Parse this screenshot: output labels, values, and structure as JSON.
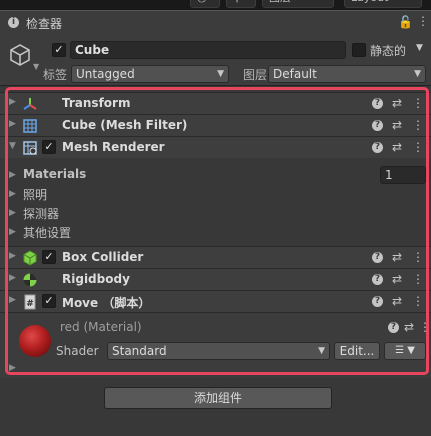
{
  "toolbar": {
    "layers_label": "图层",
    "layout_label": "Layout"
  },
  "tab": {
    "title": "检查器"
  },
  "gameobject": {
    "name": "Cube",
    "active": true,
    "static_label": "静态的",
    "tag_label": "标签",
    "tag_value": "Untagged",
    "layer_label": "图层",
    "layer_value": "Default"
  },
  "components": [
    {
      "title": "Transform",
      "checkbox": false,
      "icon": "transform-axes-icon"
    },
    {
      "title": "Cube (Mesh Filter)",
      "checkbox": false,
      "icon": "mesh-filter-grid-icon"
    },
    {
      "title": "Mesh Renderer",
      "checkbox": true,
      "icon": "mesh-renderer-icon"
    },
    {
      "title": "Box Collider",
      "checkbox": true,
      "icon": "box-collider-icon"
    },
    {
      "title": "Rigidbody",
      "checkbox": false,
      "icon": "rigidbody-sphere-icon"
    },
    {
      "title": "Move （脚本）",
      "checkbox": true,
      "icon": "script-icon"
    }
  ],
  "mesh_renderer": {
    "materials_label": "Materials",
    "materials_count": "1",
    "lighting_label": "照明",
    "probes_label": "探测器",
    "additional_label": "其他设置"
  },
  "material": {
    "name": "red (Material)",
    "shader_label": "Shader",
    "shader_value": "Standard",
    "edit_label": "Edit...",
    "color_hint": "#c0392b"
  },
  "add_component_label": "添加组件",
  "colors": {
    "highlight": "#e8455e"
  }
}
